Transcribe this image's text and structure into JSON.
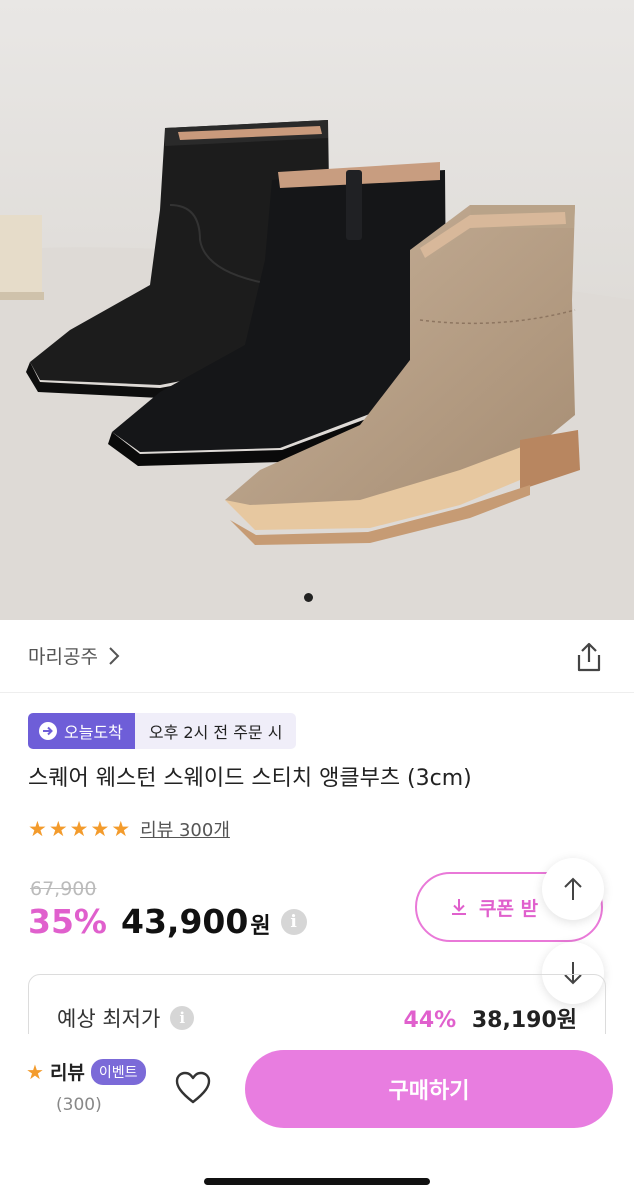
{
  "brand": {
    "name": "마리공주"
  },
  "badges": {
    "today": "오늘도착",
    "cutoff": "오후 2시 전 주문 시"
  },
  "product": {
    "title": "스퀘어 웨스턴 스웨이드 스티치 앵클부츠 (3cm)"
  },
  "rating": {
    "stars": 5,
    "review_link": "리뷰 300개"
  },
  "price": {
    "original": "67,900",
    "discount": "35%",
    "amount": "43,900",
    "currency": "원",
    "info": "i"
  },
  "coupon": {
    "label": "쿠폰 받"
  },
  "lowest": {
    "label": "예상 최저가",
    "info": "i",
    "discount": "44%",
    "amount": "38,190원"
  },
  "bottom_bar": {
    "review_label": "리뷰",
    "event_badge": "이벤트",
    "review_count": "(300)",
    "buy_label": "구매하기"
  },
  "carousel": {
    "slide_count": 1,
    "active_slide": 1
  },
  "icons": {
    "share": "share-icon",
    "chevron": "chevron-right-icon",
    "heart": "heart-icon",
    "up": "arrow-up-icon",
    "down": "arrow-down-icon",
    "download": "download-icon",
    "truck": "delivery-icon",
    "star": "star-icon"
  },
  "colors": {
    "accent": "#e060cd",
    "buy_button": "#e87de0",
    "badge_purple": "#6e5ed8",
    "star": "#f39b2c"
  }
}
